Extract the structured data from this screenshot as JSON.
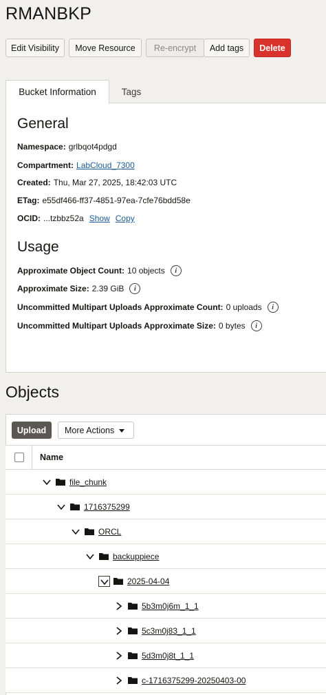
{
  "page": {
    "title": "RMANBKP"
  },
  "toolbar": {
    "edit_visibility": "Edit Visibility",
    "move_resource": "Move Resource",
    "re_encrypt": "Re-encrypt",
    "add_tags": "Add tags",
    "delete": "Delete"
  },
  "tabs": {
    "bucket_information": "Bucket Information",
    "tags": "Tags"
  },
  "general": {
    "heading": "General",
    "namespace_label": "Namespace:",
    "namespace_value": "grlbqot4pdgd",
    "compartment_label": "Compartment:",
    "compartment_value": "LabCloud_7300",
    "created_label": "Created:",
    "created_value": "Thu, Mar 27, 2025, 18:42:03 UTC",
    "etag_label": "ETag:",
    "etag_value": "e55df466-ff37-4851-97ea-7cfe76bdd58e",
    "ocid_label": "OCID:",
    "ocid_value": "...tzbbz52a",
    "show_link": "Show",
    "copy_link": "Copy"
  },
  "usage": {
    "heading": "Usage",
    "object_count_label": "Approximate Object Count:",
    "object_count_value": "10 objects",
    "size_label": "Approximate Size:",
    "size_value": "2.39 GiB",
    "multipart_count_label": "Uncommitted Multipart Uploads Approximate Count:",
    "multipart_count_value": "0 uploads",
    "multipart_size_label": "Uncommitted Multipart Uploads Approximate Size:",
    "multipart_size_value": "0 bytes"
  },
  "objects": {
    "title": "Objects",
    "upload_button": "Upload",
    "more_actions_button": "More Actions",
    "name_header": "Name",
    "tree": [
      {
        "label": "file_chunk",
        "expanded": true,
        "level": 0
      },
      {
        "label": "1716375299",
        "expanded": true,
        "level": 1
      },
      {
        "label": "ORCL",
        "expanded": true,
        "level": 2
      },
      {
        "label": "backuppiece",
        "expanded": true,
        "level": 3
      },
      {
        "label": "2025-04-04",
        "expanded": true,
        "level": 4,
        "focused": true
      },
      {
        "label": "5b3m0j6m_1_1",
        "expanded": false,
        "level": 5
      },
      {
        "label": "5c3m0j83_1_1",
        "expanded": false,
        "level": 5
      },
      {
        "label": "5d3m0j8t_1_1",
        "expanded": false,
        "level": 5
      },
      {
        "label": "c-1716375299-20250403-00",
        "expanded": false,
        "level": 5
      }
    ]
  },
  "icons": {
    "info": "info-icon",
    "folder": "folder-icon",
    "chevron_down": "chevron-down-icon",
    "chevron_right": "chevron-right-icon"
  },
  "colors": {
    "danger": "#d9322c",
    "link": "#1c5b96",
    "upload_button": "#5b5752"
  }
}
